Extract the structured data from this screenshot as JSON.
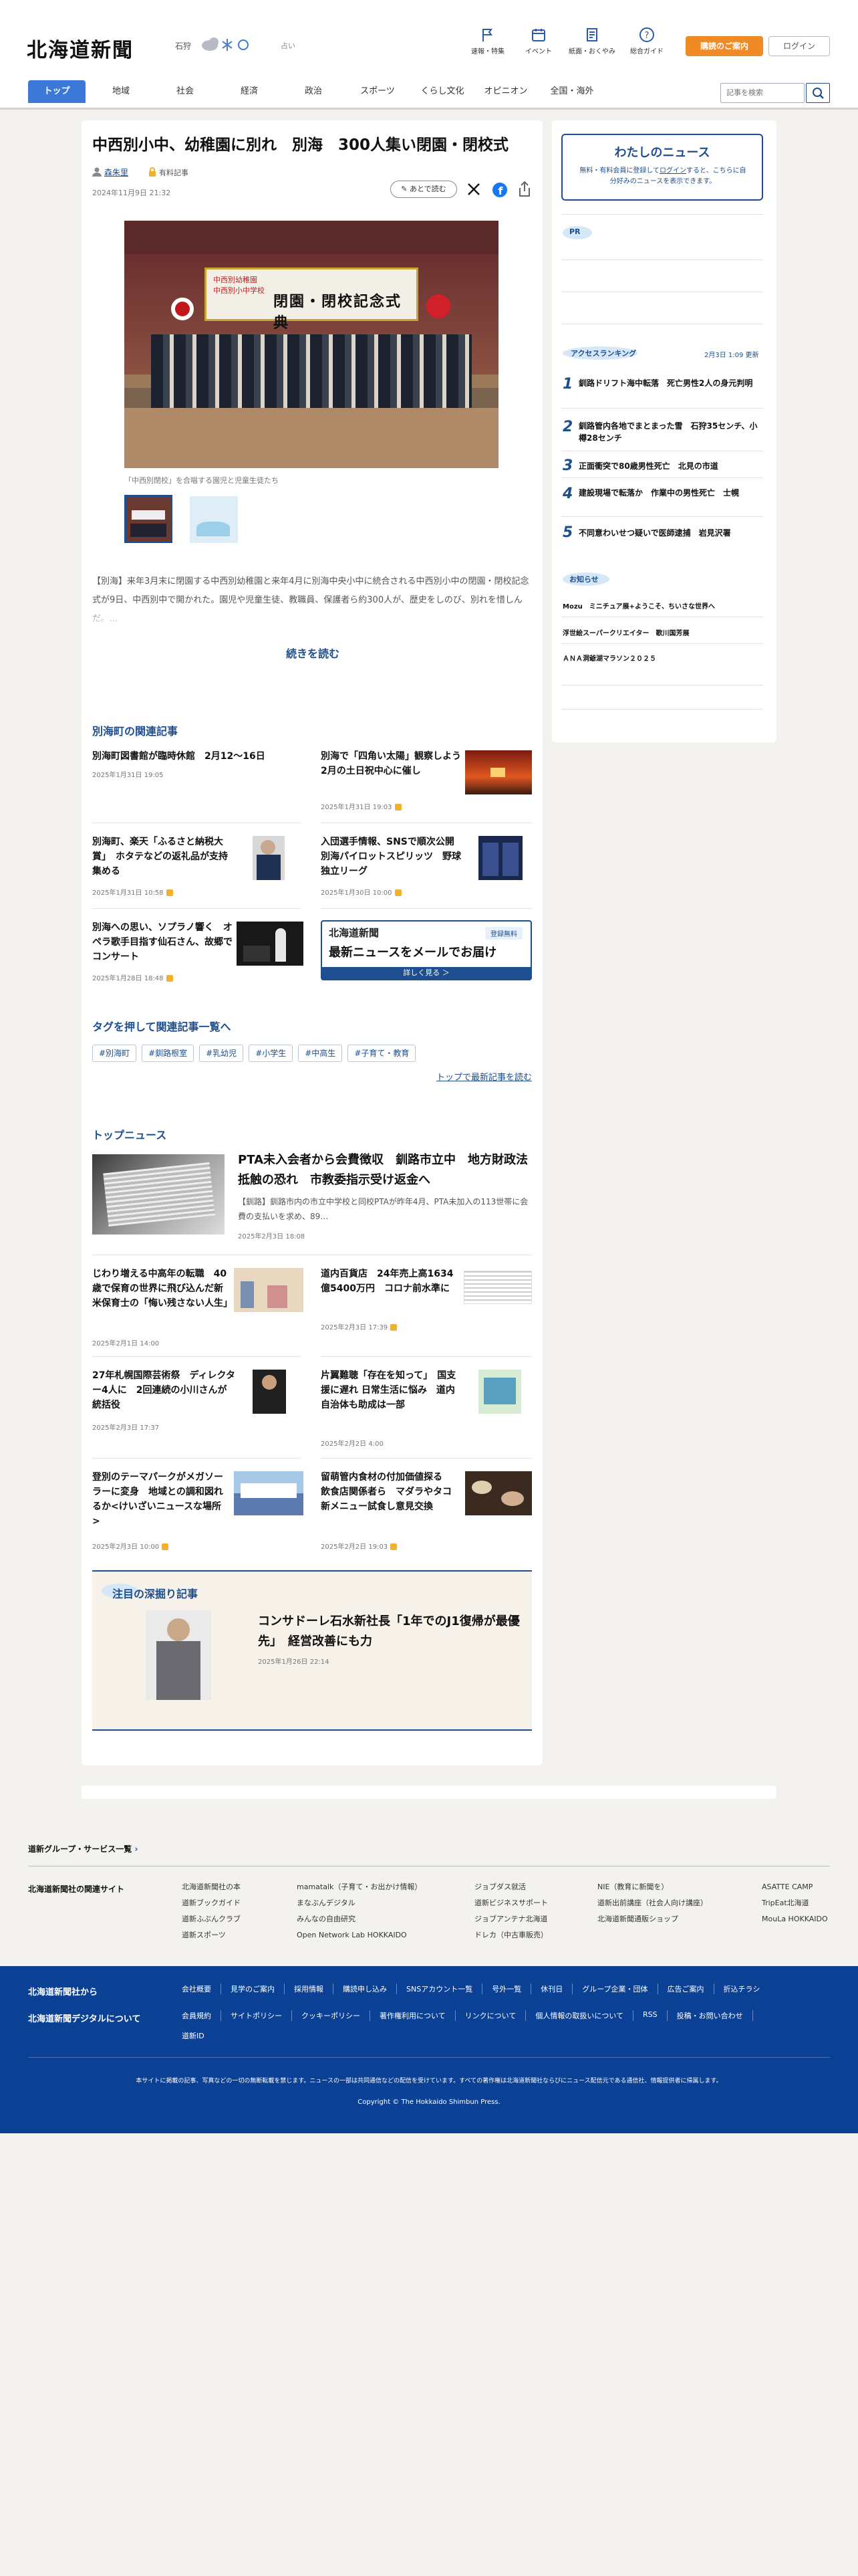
{
  "header": {
    "logo": "北海道新聞",
    "location": "石狩",
    "weather_icon": "cloud-snow-icon",
    "util_label": "占い",
    "icons": [
      {
        "label": "速報・特集",
        "icon": "flag-icon"
      },
      {
        "label": "イベント",
        "icon": "calendar-icon"
      },
      {
        "label": "紙面・おくやみ",
        "icon": "newspaper-icon"
      },
      {
        "label": "総合ガイド",
        "icon": "help-icon"
      }
    ],
    "join": "購読のご案内",
    "login": "ログイン"
  },
  "nav": {
    "items": [
      "トップ",
      "地域",
      "社会",
      "経済",
      "政治",
      "スポーツ",
      "くらし文化",
      "オピニオン",
      "全国・海外"
    ],
    "search_placeholder": "記事を検索"
  },
  "article": {
    "title": "中西別小中、幼稚園に別れ　別海　300人集い閉園・閉校式",
    "author": "森朱里",
    "badge": "有料記事",
    "date": "2024年11月9日 21:32",
    "save": "あとで読む",
    "banner1": "中西別幼稚園",
    "banner2": "中西別小中学校",
    "banner_main": "閉園・閉校記念式典",
    "caption": "「中西別閉校」を合唱する園児と児童生徒たち",
    "lead": "【別海】来年3月末に閉園する中西別幼稚園と来年4月に別海中央小中に統合される中西別小中の閉園・閉校記念式が9日、中西別中で開かれた。園児や児童生徒、教職員、保護者ら約300人が、歴史をしのび、別れを惜しんだ。…",
    "more": "続きを読む"
  },
  "related": {
    "title": "別海町の関連記事",
    "items": [
      {
        "title": "別海町図書館が臨時休館　2月12〜16日",
        "date": "2025年1月31日 19:05",
        "key": false
      },
      {
        "title": "別海で「四角い太陽」観察しよう　2月の土日祝中心に催し",
        "date": "2025年1月31日 19:03",
        "key": true
      },
      {
        "title": "別海町、楽天「ふるさと納税大賞」　ホタテなどの返礼品が支持集める",
        "date": "2025年1月31日 10:58",
        "key": true
      },
      {
        "title": "入団選手情報、SNSで順次公開　別海パイロットスピリッツ　野球独立リーグ",
        "date": "2025年1月30日 10:00",
        "key": true
      },
      {
        "title": "別海への思い、ソプラノ響く　オペラ歌手目指す仙石さん、故郷でコンサート",
        "date": "2025年1月28日 18:48",
        "key": true
      }
    ],
    "ad_logo": "北海道新聞",
    "ad_tag": "登録無料",
    "ad_main": "最新ニュースをメールでお届け",
    "ad_btn": "詳しく見る ＞"
  },
  "tags": {
    "title": "タグを押して関連記事一覧へ",
    "items": [
      "#別海町",
      "#釧路根室",
      "#乳幼児",
      "#小学生",
      "#中高生",
      "#子育て・教育"
    ],
    "top_link": "トップで最新記事を読む"
  },
  "topnews": {
    "title": "トップニュース",
    "lead_title": "PTA未入会者から会費徴収　釧路市立中　地方財政法抵触の恐れ　市教委指示受け返金へ",
    "lead_body": "【釧路】釧路市内の市立中学校と同校PTAが昨年4月、PTA未加入の113世帯に会費の支払いを求め、89…",
    "lead_date": "2025年2月3日 18:08",
    "items": [
      {
        "title": "じわり増える中高年の転職　40歳で保育の世界に飛び込んだ新米保育士の「悔い残さない人生」",
        "date": "2025年2月1日 14:00",
        "key": false
      },
      {
        "title": "道内百貨店　24年売上高1634億5400万円　コロナ前水準に",
        "date": "2025年2月3日 17:39",
        "key": true
      },
      {
        "title": "27年札幌国際芸術祭　ディレクター4人に　2回連続の小川さんが統括役",
        "date": "2025年2月3日 17:37",
        "key": false
      },
      {
        "title": "片翼難聴「存在を知って」　国支援に遅れ 日常生活に悩み　道内自治体も助成は一部",
        "date": "2025年2月2日 4:00",
        "key": false
      },
      {
        "title": "登別のテーマパークがメガソーラーに変身　地域との調和図れるか<けいざいニュースな場所>",
        "date": "2025年2月3日 10:00",
        "key": true
      },
      {
        "title": "留萌管内食材の付加価値探る　飲食店関係者ら　マダラやタコ　新メニュー試食し意見交換",
        "date": "2025年2月2日 19:03",
        "key": true
      }
    ]
  },
  "feature": {
    "title": "注目の深掘り記事",
    "item_title": "コンサドーレ石水新社長「1年でのJ1復帰が最優先」　経営改善にも力",
    "item_date": "2025年1月26日 22:14"
  },
  "sidebar": {
    "my_title": "わたしのニュース",
    "my_body1": "無料・有料会員に登録して",
    "my_link": "ログイン",
    "my_body2": "すると、こちらに自分好みのニュースを表示できます。",
    "pr": "PR",
    "rank_title": "アクセスランキング",
    "rank_updated": "2月3日 1:09 更新",
    "rank": [
      {
        "n": "1",
        "t": "釧路ドリフト海中転落　死亡男性2人の身元判明"
      },
      {
        "n": "2",
        "t": "釧路管内各地でまとまった雪　石狩35センチ、小樽28センチ"
      },
      {
        "n": "3",
        "t": "正面衝突で80歳男性死亡　北見の市道"
      },
      {
        "n": "4",
        "t": "建設現場で転落か　作業中の男性死亡　士幌"
      },
      {
        "n": "5",
        "t": "不同意わいせつ疑いで医師逮捕　岩見沢署"
      }
    ],
    "info_title": "お知らせ",
    "info": [
      "Mozu　ミニチュア展+ようこそ、ちいさな世界へ",
      "浮世絵スーパークリエイター　歌川国芳展",
      "ＡＮＡ洞爺湖マラソン２０２５"
    ]
  },
  "services": {
    "title": "道新グループ・サービス一覧",
    "col_head": "北海道新聞社の関連サイト",
    "cols": [
      [
        "北海道新聞社の本",
        "道新ブックガイド",
        "道新ふぶんクラブ",
        "道新スポーツ"
      ],
      [
        "mamatalk（子育て・お出かけ情報）",
        "まなぶんデジタル",
        "みんなの自由研究",
        "Open Network Lab HOKKAIDO"
      ],
      [
        "ジョブダス就活",
        "道新ビジネスサポート",
        "ジョブアンテナ北海道",
        "ドレカ（中古車販売）"
      ],
      [
        "NIE（教育に新聞を）",
        "道新出前講座（社会人向け講座）",
        "北海道新聞通販ショップ"
      ],
      [
        "ASATTE CAMP",
        "TripEat北海道",
        "MouLa HOKKAIDO"
      ]
    ]
  },
  "footer": {
    "h1": "北海道新聞社から",
    "h2": "北海道新聞デジタルについて",
    "row1": [
      "会社概要",
      "見学のご案内",
      "採用情報",
      "購読申し込み",
      "SNSアカウント一覧",
      "号外一覧",
      "休刊日",
      "グループ企業・団体",
      "広告ご案内",
      "折込チラシ"
    ],
    "row2": [
      "会員規約",
      "サイトポリシー",
      "クッキーポリシー",
      "著作権利用について",
      "リンクについて",
      "個人情報の取扱いについて",
      "RSS",
      "投稿・お問い合わせ",
      "道新ID"
    ],
    "notice": "本サイトに掲載の記事、写真などの一切の無断転載を禁じます。ニュースの一部は共同通信などの配信を受けています。すべての著作権は北海道新聞社ならびにニュース配信元である通信社、情報提供者に帰属します。",
    "copyright": "Copyright © The Hokkaido Shimbun Press."
  }
}
